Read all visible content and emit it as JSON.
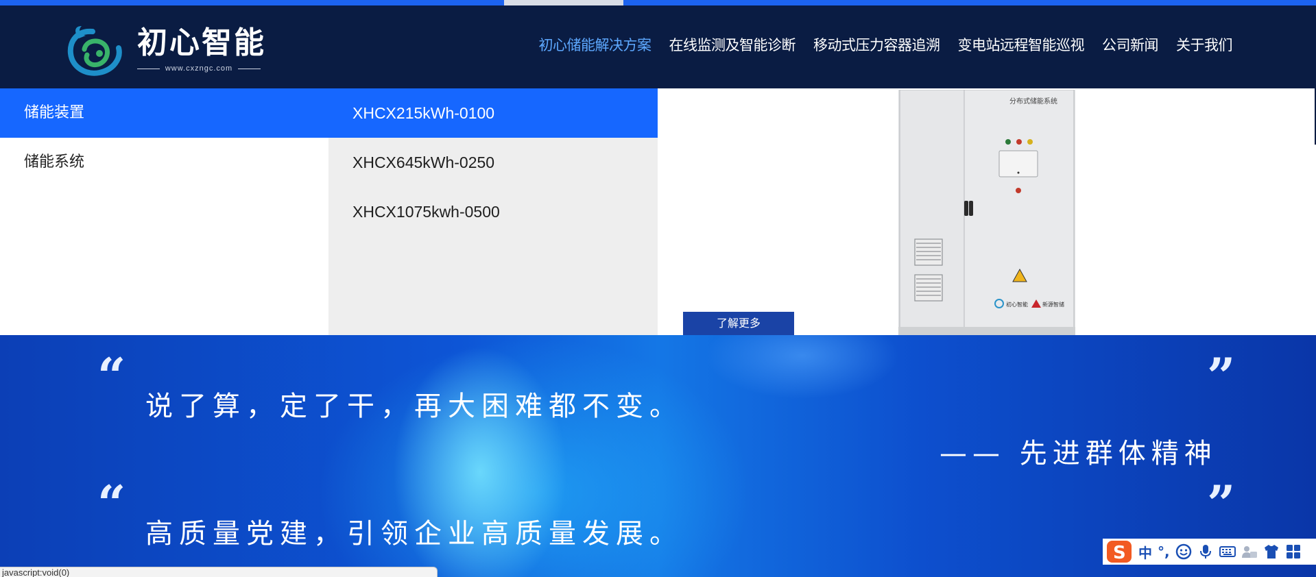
{
  "brand": {
    "name": "初心智能",
    "url": "www.cxzngc.com"
  },
  "nav": {
    "items": [
      {
        "label": "初心储能解决方案",
        "active": true
      },
      {
        "label": "在线监测及智能诊断"
      },
      {
        "label": "移动式压力容器追溯"
      },
      {
        "label": "变电站远程智能巡视"
      },
      {
        "label": "公司新闻"
      },
      {
        "label": "关于我们"
      }
    ]
  },
  "dropdown": {
    "categories": [
      {
        "label": "储能装置",
        "active": true
      },
      {
        "label": "储能系统"
      }
    ],
    "products": [
      {
        "label": "XHCX215kWh-0100",
        "active": true
      },
      {
        "label": "XHCX645kWh-0250"
      },
      {
        "label": "XHCX1075kwh-0500"
      }
    ],
    "more_button": "了解更多",
    "product_image": {
      "panel_title": "分布式储能系统",
      "brand_left": "初心智能",
      "brand_right": "新源智储"
    }
  },
  "banner": {
    "quote1": "说了算，定了干，再大困难都不变。",
    "attribution": "—— 先进群体精神",
    "quote2": "高质量党建，引领企业高质量发展。",
    "open_quote": "“",
    "close_quote": "”"
  },
  "status_bar": {
    "text": "javascript:void(0)"
  },
  "ime": {
    "mode": "中",
    "punct": "°,"
  },
  "colors": {
    "accent": "#1667ff",
    "header_bg": "#0a1c43",
    "nav_active": "#5da8ff"
  }
}
